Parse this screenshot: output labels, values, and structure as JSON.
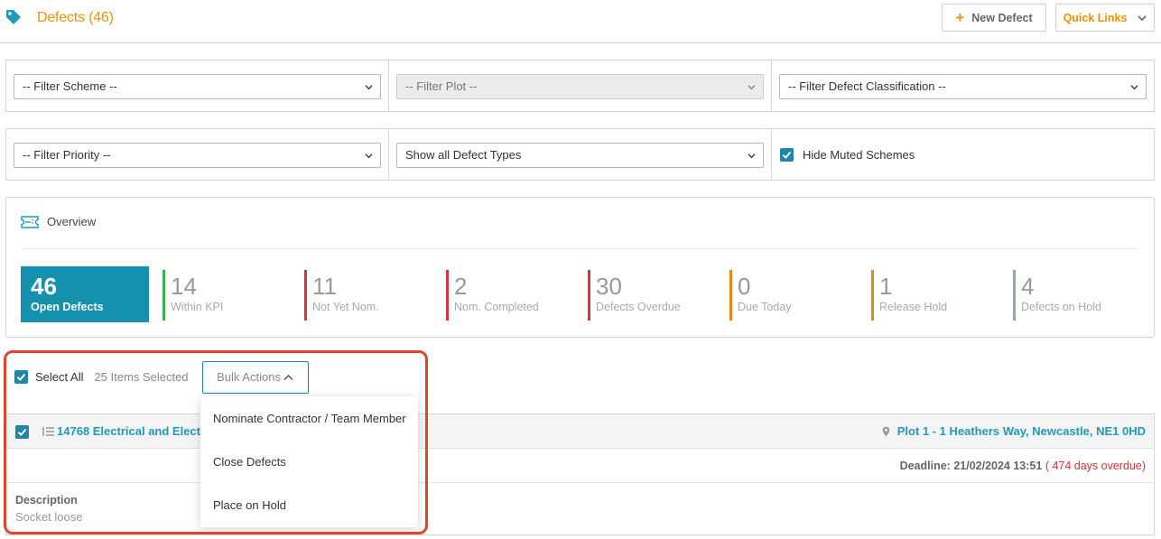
{
  "header": {
    "title": "Defects (46)",
    "new_defect_label": "New Defect",
    "quick_links_label": "Quick Links",
    "accent_color": "#f39200"
  },
  "filters": {
    "scheme": "-- Filter Scheme --",
    "plot": "-- Filter Plot --",
    "classification": "-- Filter Defect Classification --",
    "priority": "-- Filter Priority --",
    "defect_types": "Show all Defect Types",
    "hide_muted_label": "Hide Muted Schemes",
    "hide_muted_checked": true
  },
  "overview": {
    "title": "Overview",
    "stats": [
      {
        "value": "46",
        "label": "Open Defects",
        "color": "#1591ad"
      },
      {
        "value": "14",
        "label": "Within KPI",
        "color": "#3cb04a"
      },
      {
        "value": "11",
        "label": "Not Yet Nom.",
        "color": "#d8323a"
      },
      {
        "value": "2",
        "label": "Nom. Completed",
        "color": "#d8323a"
      },
      {
        "value": "30",
        "label": "Defects Overdue",
        "color": "#d8323a"
      },
      {
        "value": "0",
        "label": "Due Today",
        "color": "#e08a1e"
      },
      {
        "value": "1",
        "label": "Release Hold",
        "color": "#e08a1e"
      },
      {
        "value": "4",
        "label": "Defects on Hold",
        "color": "#9aa4ae"
      }
    ]
  },
  "selection": {
    "select_all_label": "Select All",
    "count_text": "25 Items Selected",
    "bulk_actions_label": "Bulk Actions"
  },
  "bulk_menu": [
    "Nominate Contractor / Team Member",
    "Close Defects",
    "Place on Hold"
  ],
  "defect": {
    "title": "14768 Electrical and Electri",
    "location": "Plot 1 - 1 Heathers Way, Newcastle, NE1 0HD",
    "deadline": "Deadline: 21/02/2024 13:51",
    "overdue": "( 474 days overdue)",
    "description_label": "Description",
    "description": "Socket loose"
  }
}
